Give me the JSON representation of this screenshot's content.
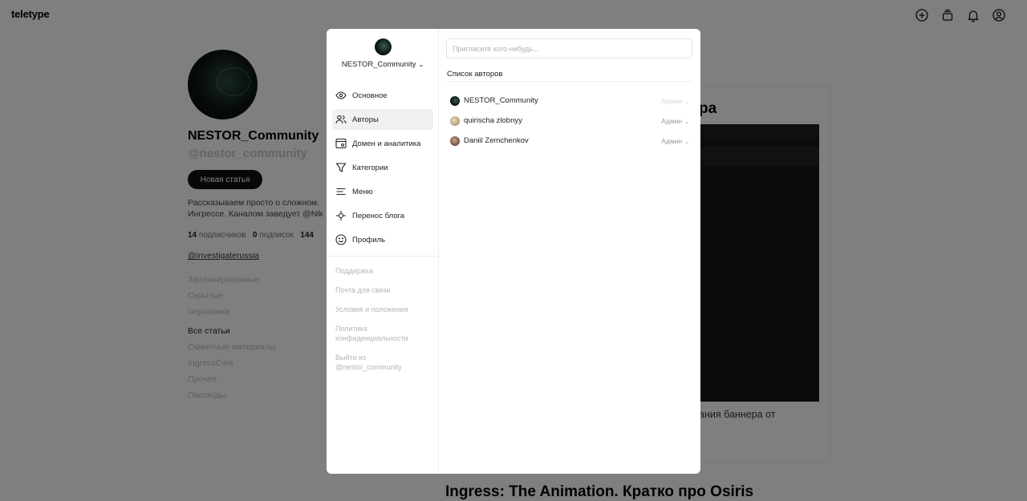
{
  "topbar": {
    "logo": "teletype",
    "icons": [
      "plus-circle-icon",
      "drafts-stack-icon",
      "bell-icon",
      "user-circle-icon"
    ]
  },
  "profile": {
    "name": "NESTOR_Community",
    "handle": "@nestor_community",
    "new_article": "Новая статья",
    "description_line1": "Рассказываем просто о сложном.",
    "description_line2": "Ингрессе. Каналом заведует @Nik",
    "stats": {
      "subscribers_count": "14",
      "subscribers_label": "подписчиков",
      "subscriptions_count": "0",
      "subscriptions_label": "подписок",
      "third_count": "144"
    },
    "link": "@investigaterussia",
    "sections": [
      "Запланированные",
      "Скрытые",
      "Черновики"
    ],
    "categories_title": "Все статьи",
    "categories": [
      "Сюжетные материалы",
      "IngressCore",
      "Прочее",
      "Пасскоды"
    ]
  },
  "articles": {
    "first_title_fragment": "ра",
    "first_text_fragment": "ания баннера от",
    "second_title": "Ingress: The Animation. Кратко про Osiris"
  },
  "modal": {
    "account_name": "NESTOR_Community",
    "nav": [
      {
        "label": "Основное",
        "icon": "eye-icon"
      },
      {
        "label": "Авторы",
        "icon": "users-icon"
      },
      {
        "label": "Домен и аналитика",
        "icon": "domain-icon"
      },
      {
        "label": "Категории",
        "icon": "funnel-icon"
      },
      {
        "label": "Меню",
        "icon": "menu-lines-icon"
      },
      {
        "label": "Перенос блога",
        "icon": "migrate-icon"
      },
      {
        "label": "Профиль",
        "icon": "smile-icon"
      }
    ],
    "links": [
      "Поддержка",
      "Почта для связи",
      "Условия и положения",
      "Политика конфиденциальности",
      "Выйти из @nestor_community"
    ],
    "invite_placeholder": "Пригласите кого-нибудь...",
    "authors_title": "Список авторов",
    "authors": [
      {
        "name": "NESTOR_Community",
        "role": "Админ"
      },
      {
        "name": "quirischa zlobnyy",
        "role": "Админ"
      },
      {
        "name": "Daniil Zemchenkov",
        "role": "Админ"
      }
    ]
  }
}
